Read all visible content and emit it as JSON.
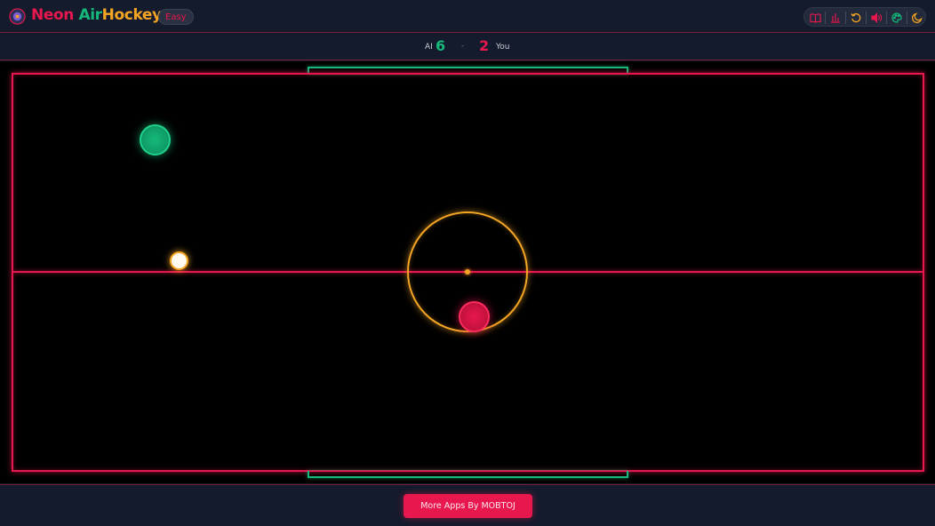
{
  "header": {
    "title_word_1": "Neon",
    "title_word_2": "Air",
    "title_word_3": "Hockey",
    "difficulty": "Easy",
    "toolbar": [
      {
        "icon": "book-icon",
        "color": "#e8174d"
      },
      {
        "icon": "bar-chart-icon",
        "color": "#e8174d"
      },
      {
        "icon": "restart-icon",
        "color": "#f5a524"
      },
      {
        "icon": "speaker-icon",
        "color": "#e8174d"
      },
      {
        "icon": "palette-icon",
        "color": "#16b97a"
      },
      {
        "icon": "moon-icon",
        "color": "#f5a524"
      }
    ]
  },
  "score": {
    "ai_label": "AI",
    "ai_score": "6",
    "separator": "-",
    "you_score": "2",
    "you_label": "You"
  },
  "footer": {
    "more_apps_label": "More Apps By MOBTOJ"
  },
  "colors": {
    "accent_red": "#e8174d",
    "accent_green": "#16b97a",
    "accent_orange": "#f5a524",
    "background": "#131a2b",
    "rink": "#000000"
  }
}
